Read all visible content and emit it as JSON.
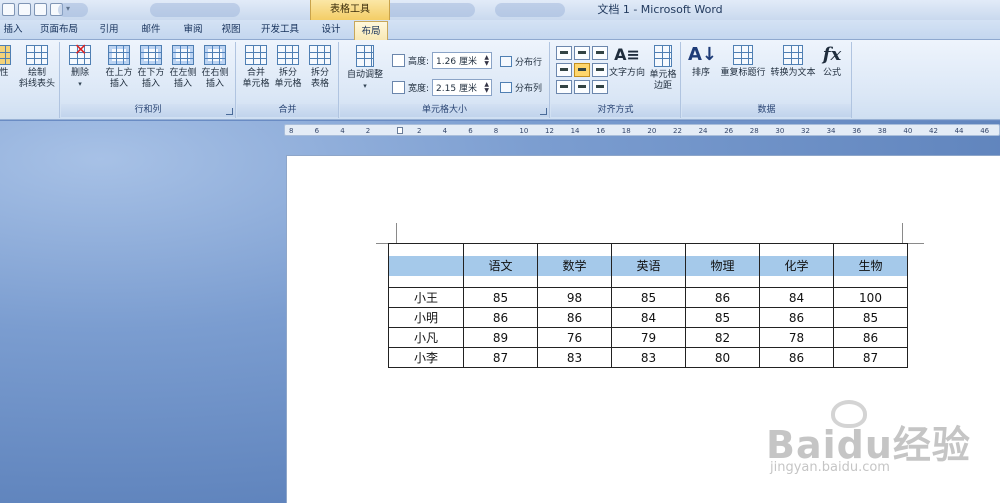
{
  "window": {
    "contextual_tab_group": "表格工具",
    "title": "文档 1 - Microsoft Word"
  },
  "ribbon_tabs": [
    {
      "label": "插入"
    },
    {
      "label": "页面布局"
    },
    {
      "label": "引用"
    },
    {
      "label": "邮件"
    },
    {
      "label": "审阅"
    },
    {
      "label": "视图"
    },
    {
      "label": "开发工具"
    },
    {
      "label": "设计"
    },
    {
      "label": "布局",
      "active": true
    }
  ],
  "ribbon": {
    "draw_group": {
      "partial_label": "性",
      "draw_diagonal_line1": "绘制",
      "draw_diagonal_line2": "斜线表头"
    },
    "rows_columns": {
      "label": "行和列",
      "delete": "删除",
      "insert_above_1": "在上方",
      "insert_above_2": "插入",
      "insert_below_1": "在下方",
      "insert_below_2": "插入",
      "insert_left_1": "在左侧",
      "insert_left_2": "插入",
      "insert_right_1": "在右侧",
      "insert_right_2": "插入"
    },
    "merge": {
      "label": "合并",
      "merge_cells_1": "合并",
      "merge_cells_2": "单元格",
      "split_cells_1": "拆分",
      "split_cells_2": "单元格",
      "split_table_1": "拆分",
      "split_table_2": "表格"
    },
    "cell_size": {
      "label": "单元格大小",
      "autofit": "自动调整",
      "height_label": "高度:",
      "height_value": "1.26 厘米",
      "width_label": "宽度:",
      "width_value": "2.15 厘米",
      "distribute_rows": "分布行",
      "distribute_cols": "分布列"
    },
    "alignment": {
      "label": "对齐方式",
      "text_direction": "文字方向",
      "cell_margins_1": "单元格",
      "cell_margins_2": "边距"
    },
    "data": {
      "label": "数据",
      "sort": "排序",
      "repeat_header": "重复标题行",
      "convert_to_text": "转换为文本",
      "formula": "公式"
    }
  },
  "ruler_labels": [
    "8",
    "6",
    "4",
    "2",
    "",
    "2",
    "4",
    "6",
    "8",
    "10",
    "12",
    "14",
    "16",
    "18",
    "20",
    "22",
    "24",
    "26",
    "28",
    "30",
    "32",
    "34",
    "36",
    "38",
    "40",
    "42",
    "44",
    "46"
  ],
  "table": {
    "headers": [
      "",
      "语文",
      "数学",
      "英语",
      "物理",
      "化学",
      "生物"
    ],
    "rows": [
      [
        "小王",
        "85",
        "98",
        "85",
        "86",
        "84",
        "100"
      ],
      [
        "小明",
        "86",
        "86",
        "84",
        "85",
        "86",
        "85"
      ],
      [
        "小凡",
        "89",
        "76",
        "79",
        "82",
        "78",
        "86"
      ],
      [
        "小李",
        "87",
        "83",
        "83",
        "80",
        "86",
        "87"
      ]
    ]
  },
  "watermark": {
    "logo": "Baidu经验",
    "url": "jingyan.baidu.com"
  }
}
